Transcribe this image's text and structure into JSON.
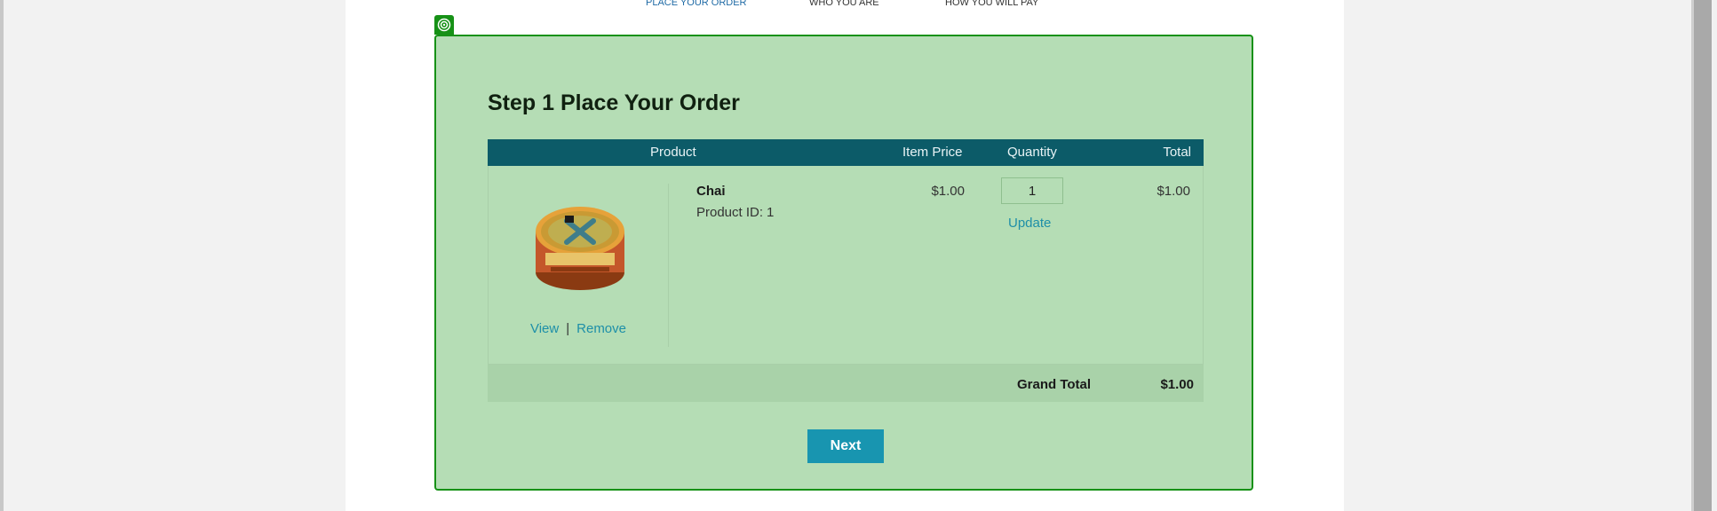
{
  "steps": {
    "step1": "PLACE YOUR ORDER",
    "step2": "WHO YOU ARE",
    "step3": "HOW YOU WILL PAY"
  },
  "panel": {
    "title": "Step 1 Place Your Order"
  },
  "table": {
    "headers": {
      "product": "Product",
      "price": "Item Price",
      "quantity": "Quantity",
      "total": "Total"
    },
    "row": {
      "name": "Chai",
      "product_id_label": "Product ID:",
      "product_id": "1",
      "price": "$1.00",
      "quantity": "1",
      "update_label": "Update",
      "total": "$1.00",
      "view_label": "View",
      "separator": "|",
      "remove_label": "Remove",
      "image_icon": "chai-tin-image"
    },
    "footer": {
      "grand_total_label": "Grand Total",
      "grand_total": "$1.00"
    }
  },
  "next_label": "Next",
  "colors": {
    "panel_bg": "#b5ddb5",
    "panel_border": "#169116",
    "header_bg": "#0c5b68",
    "button_bg": "#1895b0",
    "link": "#1e8fa8"
  }
}
